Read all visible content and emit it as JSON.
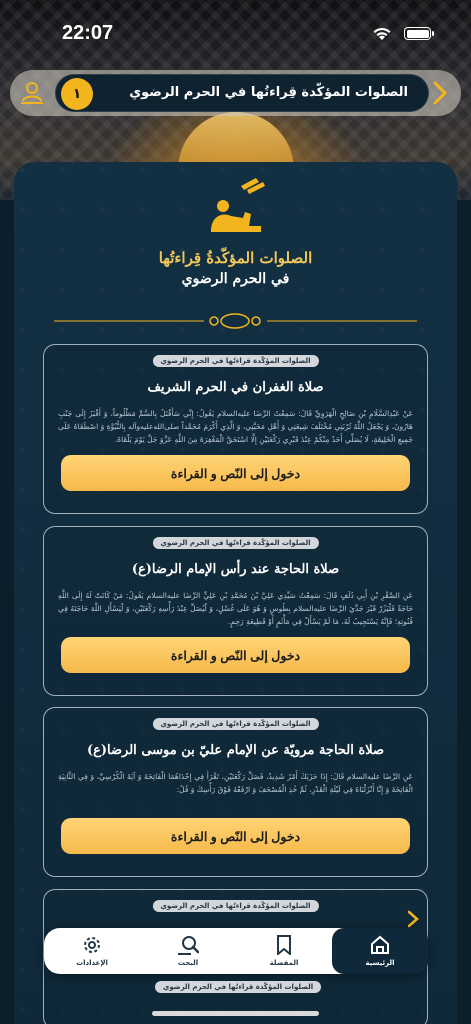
{
  "status": {
    "time": "22:07"
  },
  "header": {
    "badge": "١",
    "title": "الصلوات المؤكّدة قِراءتُها في الحرم الرضوي"
  },
  "panel": {
    "title_line1": "الصلوات المؤكّدةُ قِراءتُها",
    "title_line2": "في الحرم الرضوي"
  },
  "cards": [
    {
      "tag": "الصلوات المؤكّدة قراءتُها في الحرم الرضوي",
      "title": "صلاة الغفران في الحرم الشريف",
      "text": "عَنْ عَبْدِالسَّلَامِ بْنِ صَالِحٍ الْهَرَوِيِّ قَالَ: سَمِعْتُ الرِّضَا عليه‌السلام يَقُولُ: إِنِّي سَأُقْتَلُ بِالسَّمِّ مَظْلُوماً، وَ أُقْبَرُ إِلَى جَنْبِ هَارُونَ، وَ يَجْعَلُ اللَّهُ تُرْبَتِي مُخْتَلَفَ شِيعَتِي وَ أَهْلِ مَحَبَّتِي، وَ الَّذِي أَكْرَمَ مُحَمَّداً صلى‌الله‌عليه‌وآله بِالنُّبُوَّةِ وَ اصْطَفَاهُ عَلَى جَمِيعِ الْخَلِيقَةِ، لَا يُصَلِّي أَحَدٌ مِنْكُمْ عِنْدَ قَبْرِي رَكْعَتَيْنِ إِلَّا اسْتَحَقَّ الْمَغْفِرَةَ مِنَ اللَّهِ عَزَّوَ جَلَّ يَوْمَ يَلْقَاهُ.",
      "button": "دخول إلى النّص و القراءة"
    },
    {
      "tag": "الصلوات المؤكّدة قراءتُها في الحرم الرضوي",
      "title": "صلاة الحاجة عند رأس الإمام الرضا(ع)",
      "text": "عَنِ الصَّقْرِ بْنِ أَبِي دُلَفٍ قَالَ: سَمِعْتُ سَيِّدِي عَلِيَّ بْنَ مُحَمَّدِ بْنِ عَلِيٍّ الرِّضَا عليه‌السلام يَقُولُ: مَنْ كَانَتْ لَهُ إِلَى اللَّهِ حَاجَةٌ فَلْيَزُرْ قَبْرَ جَدِّيَ الرِّضَا عليه‌السلام بِطُوسٍ وَ هُوَ عَلَى غُسْلٍ، وَ لْيُصَلِّ عِنْدَ رَأْسِهِ رَكْعَتَيْنِ، وَ لْيَسْأَلِ اللَّهَ حَاجَتَهُ فِي قُنُوتِهِ؛ فَإِنَّهُ يَسْتَجِيبُ لَهُ، مَا لَمْ يَسْأَلْ فِي مَأْثَمٍ أَوْ قَطِيعَةِ رَحِمٍ.",
      "button": "دخول إلى النّص و القراءة"
    },
    {
      "tag": "الصلوات المؤكّدة قراءتُها في الحرم الرضوي",
      "title": "صلاة الحاجة مرويّة عن الإمام عليّ بن موسى الرضا(ع)",
      "text": "عَنِ الرِّضَا عليه‌السلام قَالَ: إِذَا حَزَبَكَ أَمْرٌ شَدِيدٌ، فَصَلِّ رَكْعَتَيْنِ، تَقْرَأُ فِي إِحْدَاهُمَا الْفَاتِحَةَ وَ آيَةَ الْكُرْسِيِّ، وَ فِي الثَّانِيَةِ الْفَاتِحَةَ وَ إِنَّا أَنْزَلْنَاهُ فِي لَيْلَةِ الْقَدْرِ، ثُمَّ خُذِ الْمُصْحَفَ وَ ارْفَعْهُ فَوْقَ رَأْسِكَ وَ قُلْ:",
      "button": "دخول إلى النّص و القراءة"
    },
    {
      "tag": "الصلوات المؤكّدة قراءتُها في الحرم الرضوي"
    }
  ],
  "tab_bar": {
    "items": [
      {
        "label": "الرئيسية",
        "icon": "home-icon",
        "active": true
      },
      {
        "label": "المفضلة",
        "icon": "bookmark-icon",
        "active": false
      },
      {
        "label": "البحث",
        "icon": "search-icon",
        "active": false
      },
      {
        "label": "الإعدادات",
        "icon": "gear-icon",
        "active": false
      }
    ]
  },
  "bottom_tag": "الصلوات المؤكّدة قراءتُها في الحرم الرضوي",
  "colors": {
    "accent": "#f3b51d",
    "button": "#f6b94b",
    "panel": "#133043"
  }
}
